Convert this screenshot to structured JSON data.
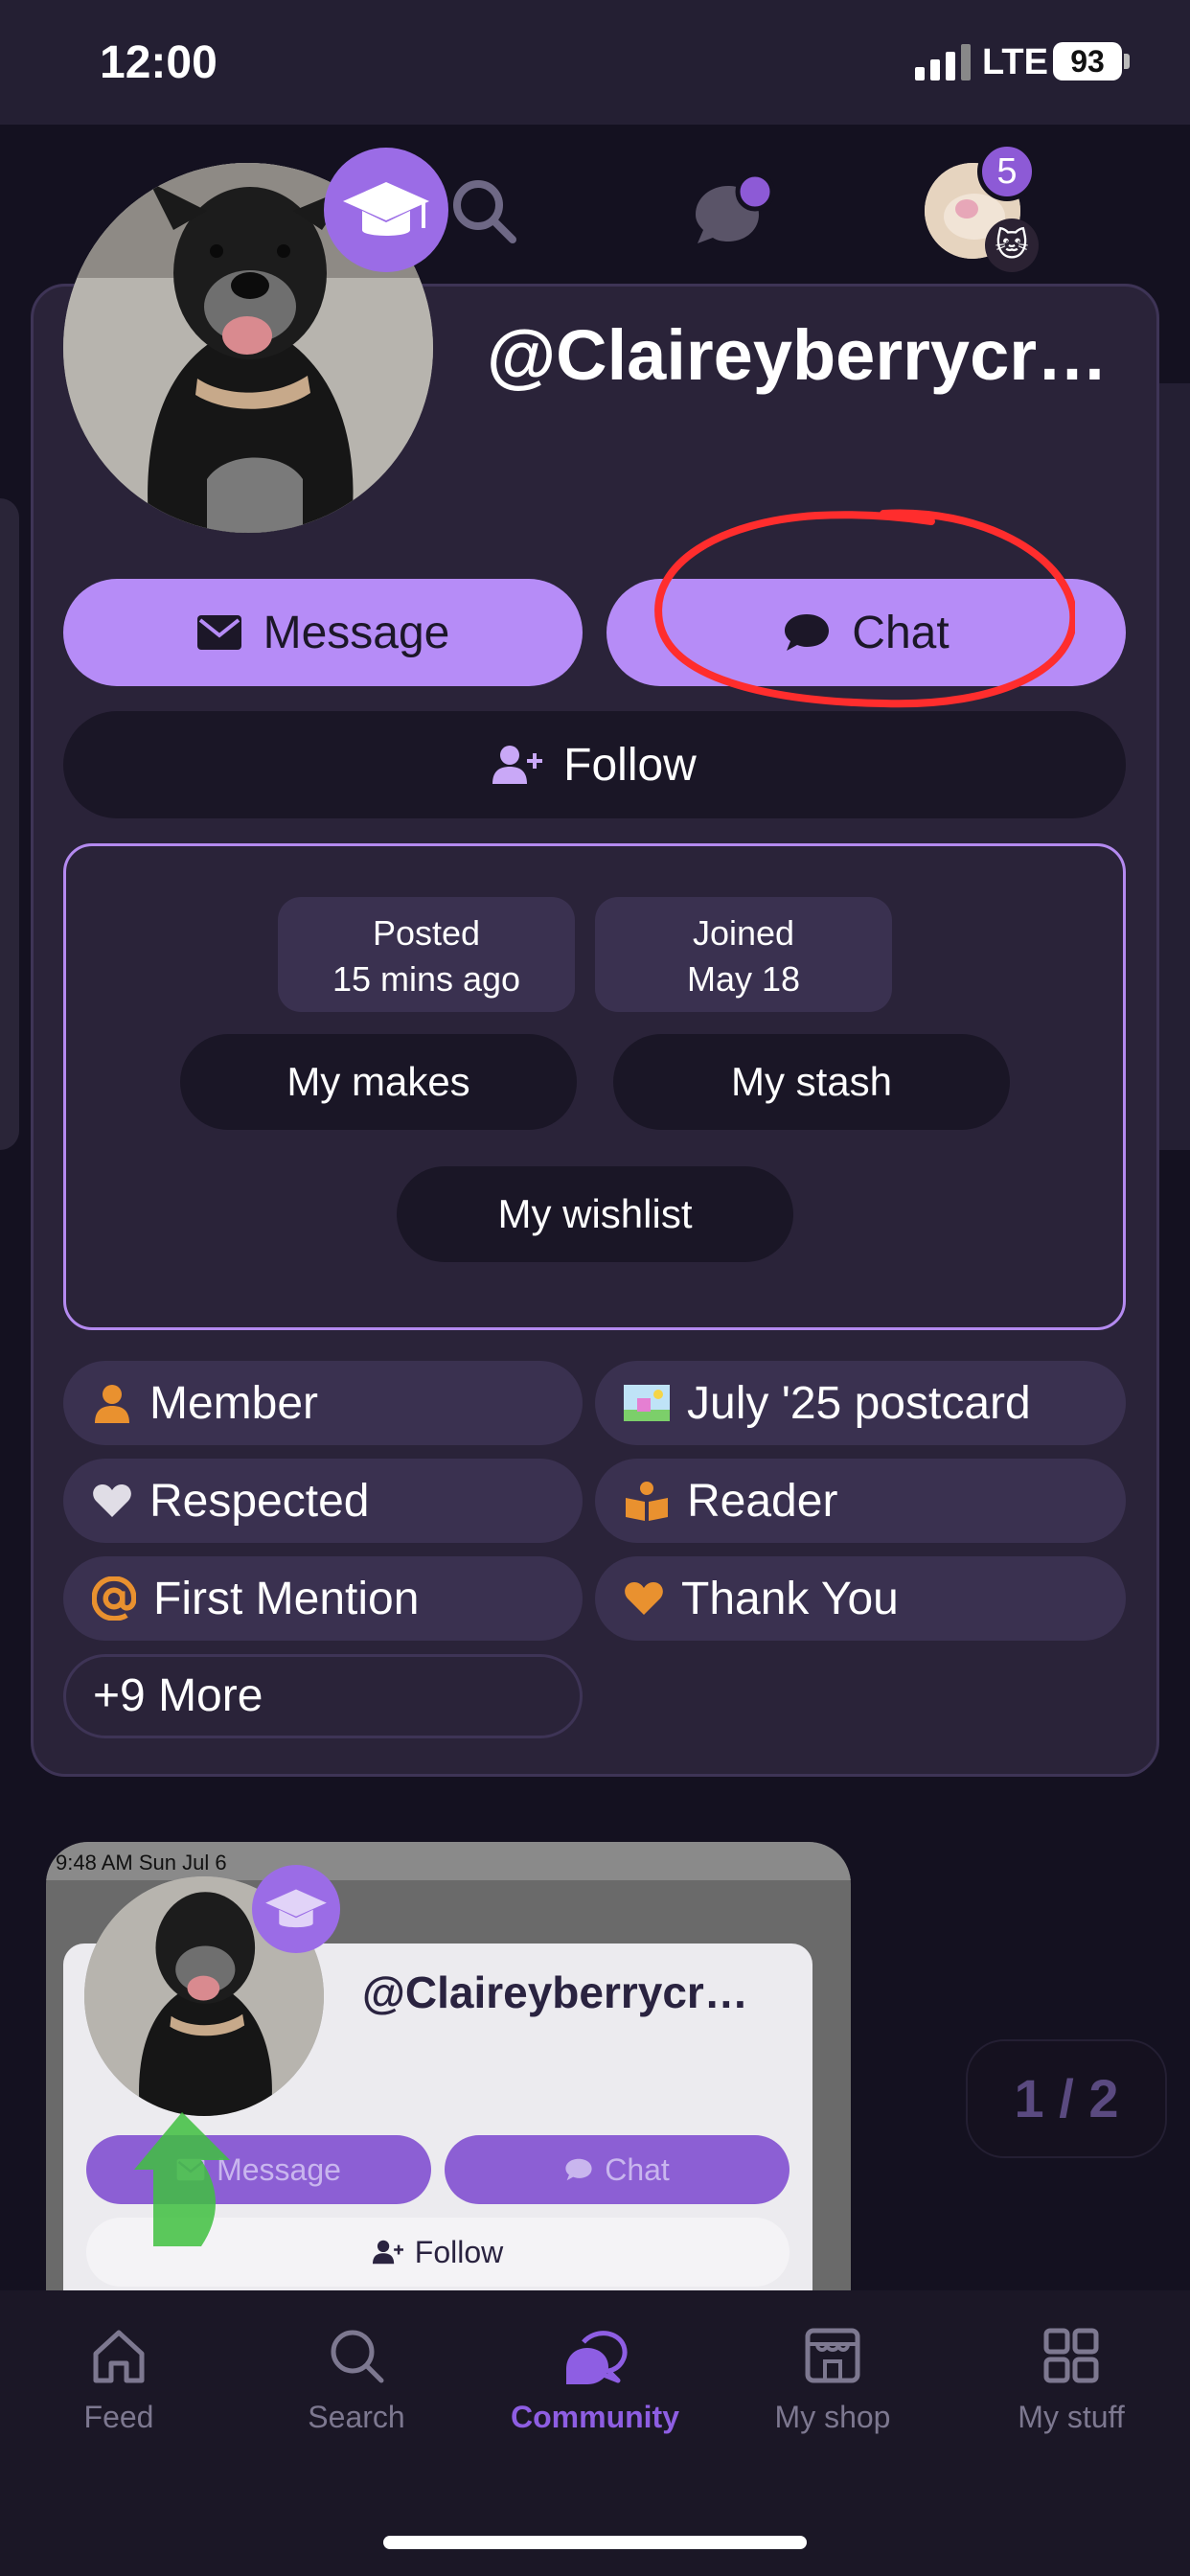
{
  "status_bar": {
    "time": "12:00",
    "network": "LTE",
    "battery": "93"
  },
  "top_bar": {
    "notification_count": "5"
  },
  "profile": {
    "username": "@Claireyberrycr…",
    "message_label": "Message",
    "chat_label": "Chat",
    "follow_label": "Follow",
    "stats": {
      "posted_label": "Posted",
      "posted_value": "15 mins ago",
      "joined_label": "Joined",
      "joined_value": "May 18"
    },
    "links": {
      "makes": "My makes",
      "stash": "My stash",
      "wishlist": "My wishlist"
    },
    "badges": [
      {
        "label": "Member",
        "icon": "person-icon"
      },
      {
        "label": "July '25 postcard",
        "icon": "postcard-icon"
      },
      {
        "label": "Respected",
        "icon": "heart-icon"
      },
      {
        "label": "Reader",
        "icon": "book-icon"
      },
      {
        "label": "First Mention",
        "icon": "at-icon"
      },
      {
        "label": "Thank You",
        "icon": "heart-icon"
      }
    ],
    "more_label": "+9 More"
  },
  "attachment": {
    "status_time": "9:48 AM   Sun Jul 6",
    "username": "@Claireyberrycr…",
    "message_label": "Message",
    "chat_label": "Chat",
    "follow_label": "Follow",
    "pager": "1 / 2"
  },
  "tabs": [
    {
      "label": "Feed",
      "icon": "home-icon"
    },
    {
      "label": "Search",
      "icon": "search-icon"
    },
    {
      "label": "Community",
      "icon": "community-icon"
    },
    {
      "label": "My shop",
      "icon": "shop-icon"
    },
    {
      "label": "My stuff",
      "icon": "grid-icon"
    }
  ],
  "colors": {
    "accent": "#b68cf7",
    "active_tab": "#8e5ee3",
    "badge_orange": "#e9912f",
    "annotation_red": "#ff2d2d"
  }
}
